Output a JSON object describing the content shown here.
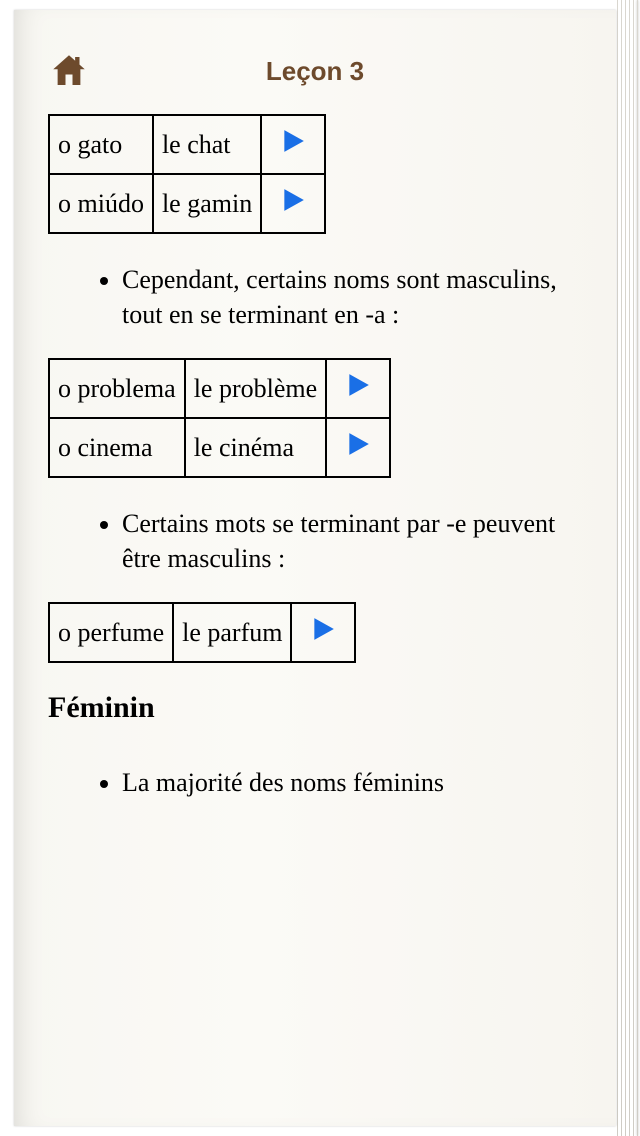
{
  "header": {
    "title": "Leçon 3"
  },
  "tables": {
    "table1": {
      "rows": [
        {
          "pt": "o gato",
          "fr": "le chat"
        },
        {
          "pt": "o miúdo",
          "fr": "le gamin"
        }
      ]
    },
    "table2": {
      "rows": [
        {
          "pt": "o problema",
          "fr": "le problème"
        },
        {
          "pt": "o cinema",
          "fr": "le cinéma"
        }
      ]
    },
    "table3": {
      "rows": [
        {
          "pt": "o perfume",
          "fr": "le parfum"
        }
      ]
    }
  },
  "notes": {
    "note1": "Cependant, certains noms sont masculins, tout en se terminant en -a :",
    "note2": "Certains mots se terminant par -e peuvent être masculins :",
    "note3": "La majorité des noms féminins"
  },
  "sections": {
    "feminin": "Féminin"
  },
  "colors": {
    "accent": "#6d4a2c",
    "play": "#1a6fe6"
  }
}
